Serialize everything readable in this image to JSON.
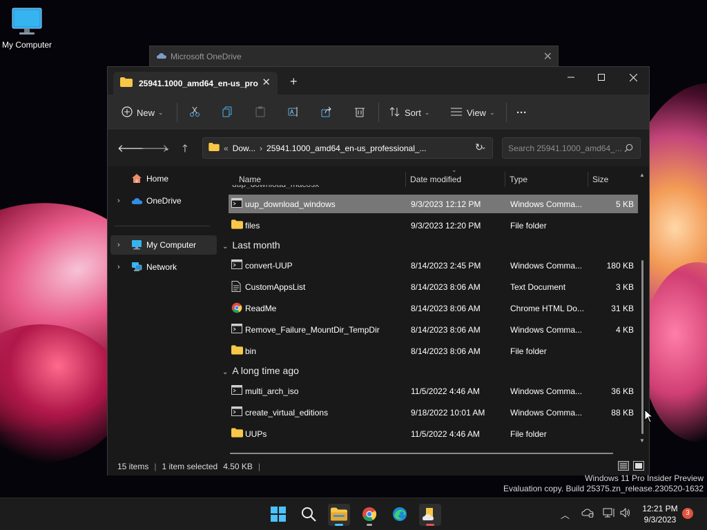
{
  "desktop": {
    "icon_label": "My Computer"
  },
  "background_window": {
    "title": "Microsoft OneDrive"
  },
  "explorer": {
    "tab_title": "25941.1000_amd64_en-us_pro",
    "toolbar": {
      "new_label": "New",
      "sort_label": "Sort",
      "view_label": "View",
      "more_label": "···"
    },
    "address": {
      "overflow": "«",
      "crumb1": "Dow...",
      "crumb2": "25941.1000_amd64_en-us_professional_..."
    },
    "search_placeholder": "Search 25941.1000_amd64_...",
    "nav": [
      "Home",
      "OneDrive",
      "My Computer",
      "Network"
    ],
    "columns": {
      "name": "Name",
      "date": "Date modified",
      "type": "Type",
      "size": "Size"
    },
    "rows_top": [
      {
        "name": "uup_download_windows",
        "date": "9/3/2023 12:12 PM",
        "type": "Windows Comma...",
        "size": "5 KB",
        "icon": "cmd-icon"
      },
      {
        "name": "files",
        "date": "9/3/2023 12:20 PM",
        "type": "File folder",
        "size": "",
        "icon": "folder-icon"
      }
    ],
    "groups": [
      "Last month",
      "A long time ago"
    ],
    "rows_last_month": [
      {
        "name": "convert-UUP",
        "date": "8/14/2023 2:45 PM",
        "type": "Windows Comma...",
        "size": "180 KB",
        "icon": "cmd-icon"
      },
      {
        "name": "CustomAppsList",
        "date": "8/14/2023 8:06 AM",
        "type": "Text Document",
        "size": "3 KB",
        "icon": "text-file-icon"
      },
      {
        "name": "ReadMe",
        "date": "8/14/2023 8:06 AM",
        "type": "Chrome HTML Do...",
        "size": "31 KB",
        "icon": "chrome-icon"
      },
      {
        "name": "Remove_Failure_MountDir_TempDir",
        "date": "8/14/2023 8:06 AM",
        "type": "Windows Comma...",
        "size": "4 KB",
        "icon": "cmd-icon"
      },
      {
        "name": "bin",
        "date": "8/14/2023 8:06 AM",
        "type": "File folder",
        "size": "",
        "icon": "folder-icon"
      }
    ],
    "rows_long_ago": [
      {
        "name": "multi_arch_iso",
        "date": "11/5/2022 4:46 AM",
        "type": "Windows Comma...",
        "size": "36 KB",
        "icon": "cmd-icon"
      },
      {
        "name": "create_virtual_editions",
        "date": "9/18/2022 10:01 AM",
        "type": "Windows Comma...",
        "size": "88 KB",
        "icon": "cmd-icon"
      },
      {
        "name": "UUPs",
        "date": "11/5/2022 4:46 AM",
        "type": "File folder",
        "size": "",
        "icon": "folder-icon"
      }
    ],
    "status": {
      "items": "15 items",
      "selected": "1 item selected",
      "size": "4.50 KB",
      "sep": "|"
    }
  },
  "watermark": {
    "line1": "Windows 11 Pro Insider Preview",
    "line2": "Evaluation copy. Build 25375.zn_release.230520-1632"
  },
  "taskbar": {
    "time": "12:21 PM",
    "date": "9/3/2023",
    "notifications": "3"
  },
  "colors": {
    "selection": "#777777",
    "folder": "#f8c748",
    "accent": "#4cc2ff"
  }
}
